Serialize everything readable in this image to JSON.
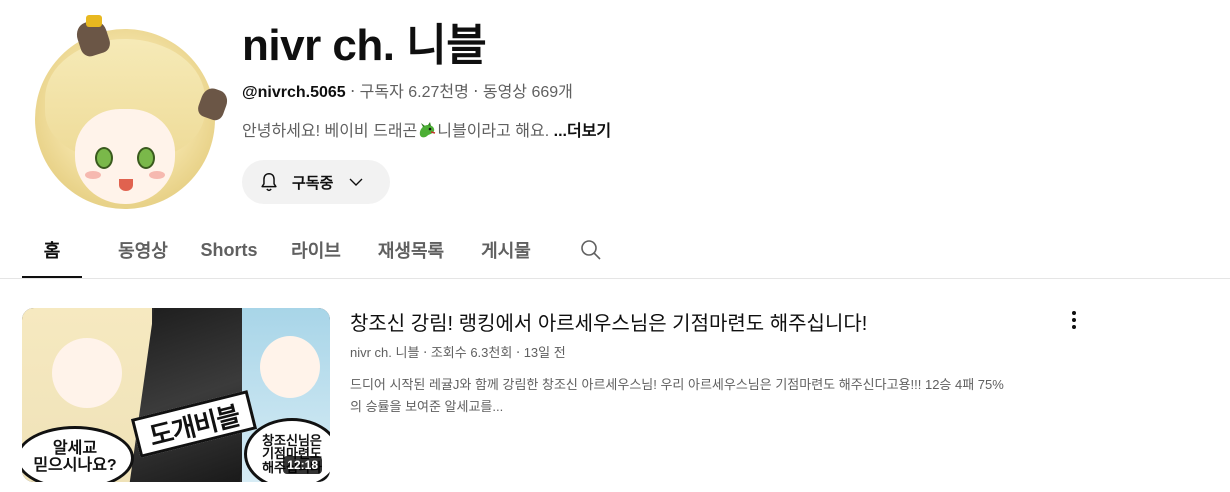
{
  "channel": {
    "title": "nivr ch. 니블",
    "handle": "@nivrch.5065",
    "subscribers": "구독자 6.27천명",
    "videos": "동영상 669개",
    "separator": "‧",
    "description": "안녕하세요! 베이비 드래곤",
    "description_after_icon": "니블이라고 해요.",
    "more_label": "...더보기"
  },
  "subscribe": {
    "label": "구독중",
    "icon": "bell-icon",
    "dropdown_icon": "chevron-down-icon"
  },
  "tabs": [
    {
      "label": "홈",
      "active": true
    },
    {
      "label": "동영상",
      "active": false
    },
    {
      "label": "Shorts",
      "active": false
    },
    {
      "label": "라이브",
      "active": false
    },
    {
      "label": "재생목록",
      "active": false
    },
    {
      "label": "게시물",
      "active": false
    }
  ],
  "search_icon": "search-icon",
  "featured_video": {
    "title": "창조신 강림! 랭킹에서 아르세우스님은 기점마련도 해주십니다!",
    "channel": "nivr ch. 니블",
    "views": "조회수 6.3천회",
    "age": "13일 전",
    "description_line1": "드디어 시작된 레귤J와 함께 강림한 창조신 아르세우스님! 우리 아르세우스님은 기점마련도 해주신다고용!!! 12승 4패 75%",
    "description_line2": "의 승률을 보여준 알세교를...",
    "duration": "12:18",
    "thumbnail": {
      "bubble_left": "알세교\n믿으시나요?",
      "banner": "도개비블",
      "bubble_right": "창조신님은\n기점마련도\n해주십니다"
    },
    "menu_icon": "more-vert-icon"
  },
  "colors": {
    "text_primary": "#0f0f0f",
    "text_secondary": "#606060",
    "button_bg": "#f2f2f2",
    "divider": "#e5e5e5"
  }
}
